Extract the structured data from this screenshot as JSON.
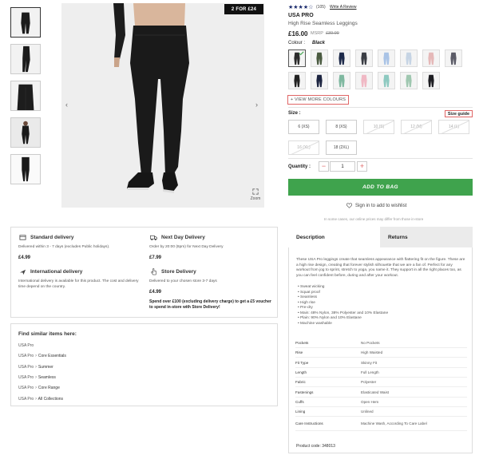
{
  "gallery": {
    "badge": "2 FOR £24",
    "zoom_label": "Zoom",
    "prev_arrow": "‹",
    "next_arrow": "›"
  },
  "product": {
    "rating_stars": "★★★★☆",
    "review_count": "(105)",
    "write_review": "Write A Review",
    "brand": "USA PRO",
    "name": "High Rise Seamless Leggings",
    "price": "£16.00",
    "msrp_label": "MSRP",
    "msrp_value": "£39.99",
    "colour_label": "Colour :",
    "colour_value": "Black",
    "view_more_colours": "+ VIEW MORE COLOURS",
    "swatch_colors_row1": [
      "#2b2b2b",
      "#4a5a40",
      "#1d2a4a",
      "#3a3d44",
      "#a9c3e6",
      "#c6d4e4",
      "#e5b8b8",
      "#5a5a66"
    ],
    "swatch_colors_row2": [
      "#222222",
      "#1c2440",
      "#7fb8a0",
      "#f0b8c4",
      "#8dc9c0",
      "#9fc7b0",
      "#1d1d22"
    ],
    "size_label": "Size :",
    "size_guide": "Size guide",
    "sizes": [
      {
        "label": "6 (XS)",
        "available": true
      },
      {
        "label": "8 (XS)",
        "available": true
      },
      {
        "label": "10 (S)",
        "available": false
      },
      {
        "label": "12 (M)",
        "available": false
      },
      {
        "label": "14 (L)",
        "available": false
      },
      {
        "label": "16 (XL)",
        "available": false
      },
      {
        "label": "18 (2XL)",
        "available": true
      }
    ],
    "quantity_label": "Quantity :",
    "quantity_minus": "−",
    "quantity_value": "1",
    "quantity_plus": "+",
    "add_to_bag": "ADD TO BAG",
    "wishlist": "Sign in to add to wishlist",
    "price_note": "In some cases, our online prices may differ from those in-store"
  },
  "delivery": {
    "standard_title": "Standard delivery",
    "standard_text": "Delivered within 3 - 7 days (excludes Public holidays).",
    "standard_price": "£4.99",
    "nextday_title": "Next Day Delivery",
    "nextday_text": "Order by 20:00 (8pm) for Next Day Delivery",
    "nextday_price": "£7.99",
    "intl_title": "International delivery",
    "intl_text": "International delivery is available for this product. The cost and delivery time depend on the country.",
    "store_title": "Store Delivery",
    "store_text": "Delivered to your chosen store 3-7 days",
    "store_price": "£4.99",
    "store_promo": "Spend over £100 (excluding delivery charge) to get a £5 voucher to spend in-store with Store Delivery!"
  },
  "similar": {
    "title": "Find similar items here:",
    "rows": [
      {
        "prefix": "USA Pro",
        "sep": "",
        "item": ""
      },
      {
        "prefix": "USA Pro",
        "sep": ">",
        "item": "Core Essentials"
      },
      {
        "prefix": "USA Pro",
        "sep": ">",
        "item": "Summer"
      },
      {
        "prefix": "USA Pro",
        "sep": ">",
        "item": "Seamless"
      },
      {
        "prefix": "USA Pro",
        "sep": ">",
        "item": "Core Range"
      },
      {
        "prefix": "USA Pro",
        "sep": ">",
        "item": "All Collections"
      }
    ]
  },
  "description": {
    "tab_description": "Description",
    "tab_returns": "Returns",
    "paragraph": "These USA Pro leggings create that seamless appearance with flattering fit on the figure. These are a high rise design, creating that forever stylish silhouette that we are a fan of. Perfect for any workout from jog to sprint, stretch to yoga, you name it. They support in all the right places too, as you can feel confident before, during and after your workout.",
    "bullets": [
      "Sweat wicking",
      "Squat proof",
      "Seamless",
      "High rise",
      "Pre-dry",
      "Main: 48% Nylon, 38% Polyester and 10% Elastane",
      "Plain: 90% Nylon and 10% Elastane",
      "Machine washable"
    ],
    "specs": [
      {
        "k": "Pockets",
        "v": "No Pockets"
      },
      {
        "k": "Rise",
        "v": "High Waisted"
      },
      {
        "k": "Fit Type",
        "v": "Skinny Fit"
      },
      {
        "k": "Length",
        "v": "Full Length"
      },
      {
        "k": "Fabric",
        "v": "Polyester"
      },
      {
        "k": "Fastenings",
        "v": "Elasticated Waist"
      },
      {
        "k": "Cuffs",
        "v": "Open Hem"
      },
      {
        "k": "Lining",
        "v": "Unlined"
      },
      {
        "k": "Care Instructions",
        "v": "Machine Wash, According To Care Label"
      }
    ],
    "product_code": "Product code: 348013"
  }
}
